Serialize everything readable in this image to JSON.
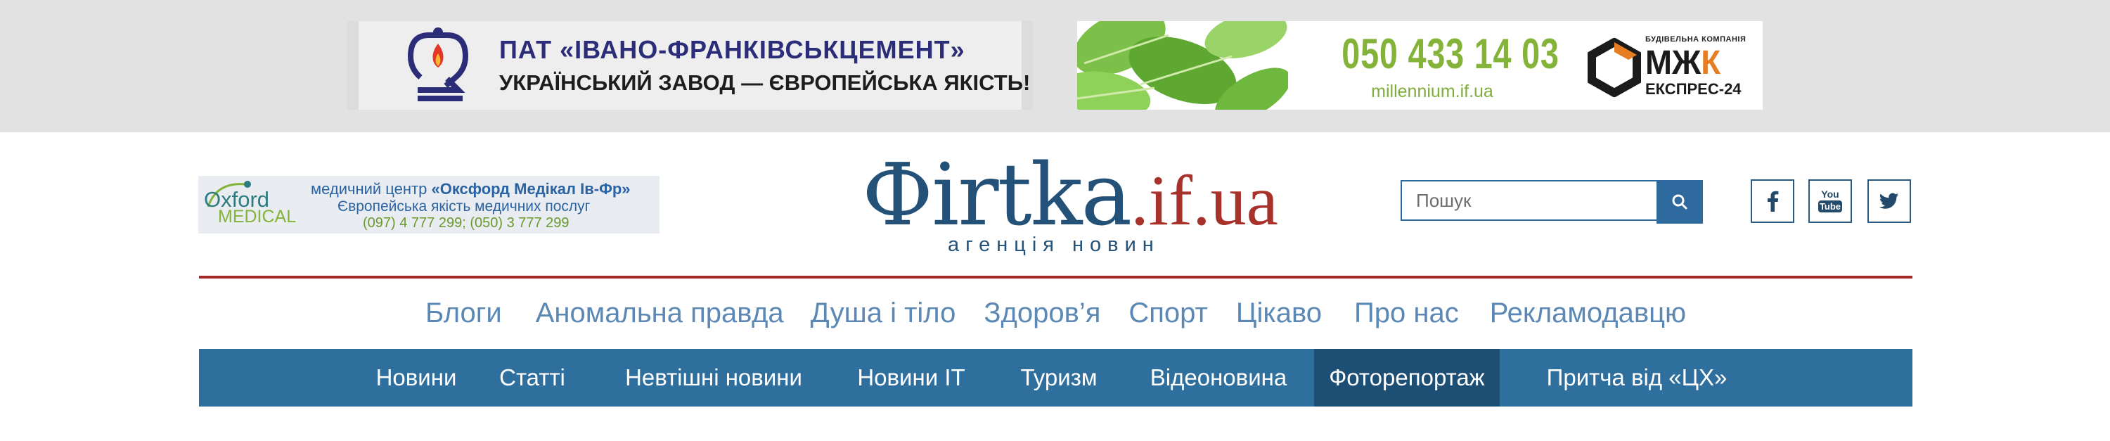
{
  "banners": {
    "left": {
      "title": "ПАТ «ІВАНО-ФРАНКІВСЬКЦЕМЕНТ»",
      "subtitle": "УКРАЇНСЬКИЙ ЗАВОД — ЄВРОПЕЙСЬКА ЯКІСТЬ!"
    },
    "right": {
      "phone": "050 433 14 03",
      "site": "millennium.if.ua",
      "company_top": "БУДІВЕЛЬНА КОМПАНІЯ",
      "company_name_a": "МЖ",
      "company_name_b": "К",
      "company_bottom": "ЕКСПРЕС-24"
    }
  },
  "oxford_ad": {
    "logo_top": "Oxford",
    "logo_bottom": "MEDICAL",
    "line1_prefix": "медичний центр ",
    "line1_bold": "«Оксфорд Медікал Ів-Фр»",
    "line2": "Європейська якість медичних послуг",
    "line3": "(097) 4 777 299; (050) 3 777 299"
  },
  "logo": {
    "main": "Фirtka",
    "domain": ".if.ua",
    "tagline": "агенція новин"
  },
  "search": {
    "placeholder": "Пошук",
    "icon": "search-icon"
  },
  "social": [
    "facebook-icon",
    "youtube-icon",
    "twitter-icon"
  ],
  "nav_primary": [
    "Блоги",
    "Аномальна правда",
    "Душа і тіло",
    "Здоров’я",
    "Спорт",
    "Цікаво",
    "Про нас",
    "Рекламодавцю"
  ],
  "nav_secondary": [
    "Новини",
    "Статті",
    "Невтішні новини",
    "Новини IT",
    "Туризм",
    "Відеоновина",
    "Фоторепортаж",
    "Притча від «ЦХ»"
  ],
  "nav_secondary_active": "Фоторепортаж",
  "colors": {
    "brand_blue": "#235178",
    "brand_red": "#a7312b",
    "nav_bar": "#2f6f9e",
    "nav_active": "#1d4f74",
    "nav_primary_text": "#5b88b5"
  }
}
